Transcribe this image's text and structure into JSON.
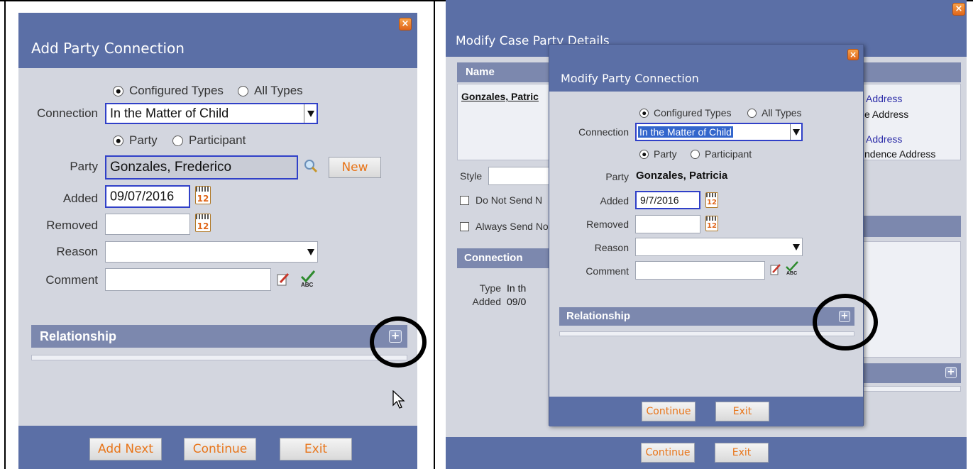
{
  "left": {
    "title": "Add Party Connection",
    "radio_types": {
      "configured": "Configured Types",
      "all": "All Types"
    },
    "connection_label": "Connection",
    "connection_value": "In the Matter of Child",
    "radio_party": {
      "party": "Party",
      "participant": "Participant"
    },
    "party_label": "Party",
    "party_value": "Gonzales, Frederico",
    "new_button": "New",
    "added_label": "Added",
    "added_value": "09/07/2016",
    "removed_label": "Removed",
    "reason_label": "Reason",
    "comment_label": "Comment",
    "relationship": "Relationship",
    "buttons": {
      "add_next": "Add Next",
      "continue": "Continue",
      "exit": "Exit"
    }
  },
  "right": {
    "title": "Modify Case Party Details",
    "name_header": "Name",
    "name_value": "Gonzales, Patric",
    "addresses": [
      {
        "link": "Address",
        "type": "e Address"
      },
      {
        "link": "Address",
        "type": "ndence Address"
      }
    ],
    "style_label": "Style",
    "do_not_send": "Do Not Send N",
    "always_send": "Always Send No",
    "connection_header": "Connection",
    "conn_rows": [
      {
        "label": "Type",
        "value": "In th"
      },
      {
        "label": "Added",
        "value": "09/0"
      }
    ],
    "buttons": {
      "continue": "Continue",
      "exit": "Exit"
    }
  },
  "inner": {
    "title": "Modify Party Connection",
    "radio_types": {
      "configured": "Configured Types",
      "all": "All Types"
    },
    "connection_label": "Connection",
    "connection_value": "In the Matter of Child",
    "radio_party": {
      "party": "Party",
      "participant": "Participant"
    },
    "party_label": "Party",
    "party_value": "Gonzales, Patricia",
    "added_label": "Added",
    "added_value": "9/7/2016",
    "removed_label": "Removed",
    "reason_label": "Reason",
    "comment_label": "Comment",
    "relationship": "Relationship",
    "buttons": {
      "continue": "Continue",
      "exit": "Exit"
    }
  },
  "icons": {
    "close": "close-icon",
    "calendar": "calendar-icon",
    "calendar_day": "12",
    "search": "search-icon",
    "edit": "edit-icon",
    "spellcheck": "spellcheck-icon",
    "spellcheck_text": "ABC",
    "plus": "plus-icon",
    "cursor": "cursor-icon"
  },
  "colors": {
    "title_bar": "#5b6fa6",
    "section_bar": "#7c88ae",
    "dialog_bg": "#d3d6df",
    "button_text": "#e8751a",
    "selection": "#3040c8"
  }
}
